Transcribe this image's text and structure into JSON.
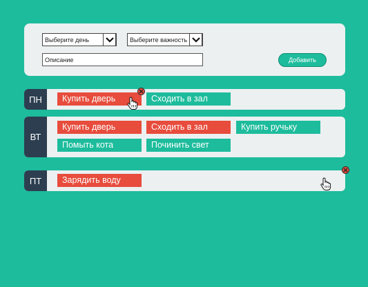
{
  "form": {
    "day_select": "Выберите день",
    "importance_select": "Выберите важность",
    "description_value": "Описание",
    "add_label": "Добавить"
  },
  "days": [
    {
      "label": "ПН",
      "tasks": [
        "Купить дверь",
        "Сходить в зал"
      ]
    },
    {
      "label": "ВТ",
      "tasks": [
        "Купить дверь",
        "Сходить в зал",
        "Купить ручьку",
        "Помыть кота",
        "Починить свет"
      ]
    },
    {
      "label": "ПТ",
      "tasks": [
        "Зарядить воду"
      ]
    }
  ],
  "colors": {
    "accent": "#1dbc9c",
    "important": "#e74c3c",
    "dark": "#2c3e50",
    "panel": "#ecf0f1"
  },
  "icons": [
    "chevron-down-icon",
    "delete-icon",
    "hand-cursor-icon"
  ]
}
